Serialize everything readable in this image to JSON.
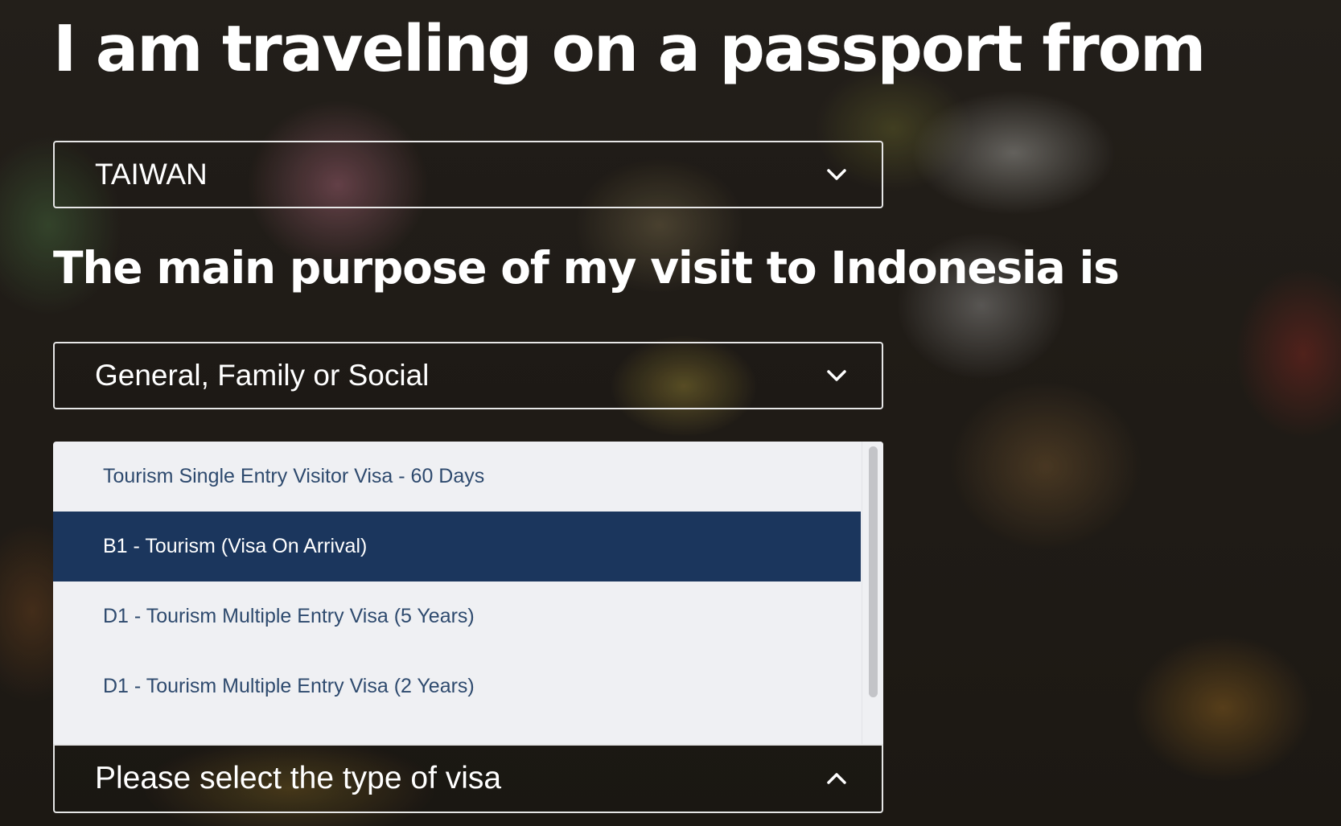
{
  "passport_heading": "I am traveling on a passport from",
  "country_select": {
    "value": "TAIWAN",
    "icon": "chevron-down-icon"
  },
  "purpose_heading": "The main purpose of my visit to Indonesia is",
  "purpose_select": {
    "value": "General, Family or Social",
    "icon": "chevron-down-icon"
  },
  "visa_dropdown": {
    "options": [
      {
        "label": "Tourism Single Entry Visitor Visa - 60 Days",
        "selected": false
      },
      {
        "label": "B1 - Tourism (Visa On Arrival)",
        "selected": true
      },
      {
        "label": "D1 - Tourism Multiple Entry Visa (5 Years)",
        "selected": false
      },
      {
        "label": "D1 - Tourism Multiple Entry Visa (2 Years)",
        "selected": false
      }
    ],
    "highlight_color": "#1b365d",
    "option_text_color": "#2e4a6e"
  },
  "visa_select": {
    "placeholder": "Please select the type of visa",
    "icon": "chevron-up-icon"
  }
}
